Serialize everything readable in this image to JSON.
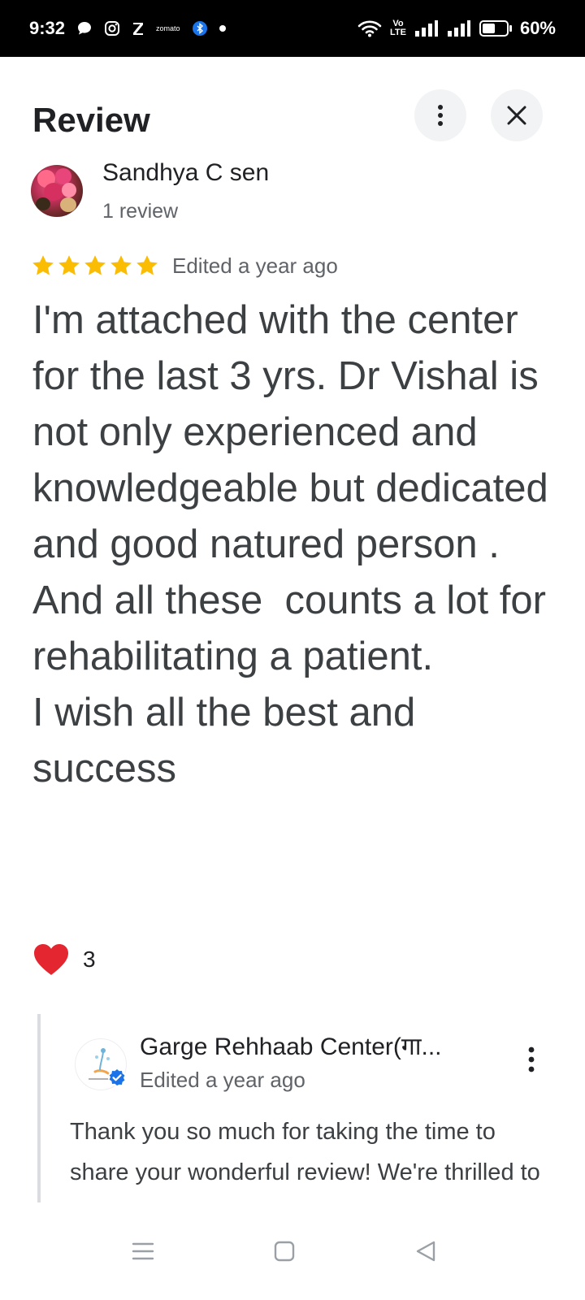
{
  "status_bar": {
    "time": "9:32",
    "left_icons": [
      "chat-icon",
      "instagram-icon",
      "zomato-z-icon",
      "zomato-label-icon",
      "bluetooth-icon",
      "dot-icon"
    ],
    "zomato_label": "zomato",
    "network_label_top": "Vo",
    "network_label_bottom": "LTE",
    "battery": "60%",
    "battery_level": 0.6
  },
  "header": {
    "title": "Review",
    "more_icon": "more-vert-icon",
    "close_icon": "close-icon"
  },
  "review": {
    "author": "Sandhya C sen",
    "author_meta": "1 review",
    "rating": 5,
    "rating_max": 5,
    "date": "Edited a year ago",
    "text": "I'm attached with the center for the last 3 yrs. Dr Vishal is not only experienced and knowledgeable but dedicated and good natured person .  And all these  counts a lot for rehabilitating a patient.\nI wish all the best and success",
    "likes": "3",
    "like_icon": "heart-icon"
  },
  "reply": {
    "owner": "Garge Rehhaab Center(गा...",
    "date": "Edited a year ago",
    "text": "Thank you so much for taking the time to share your wonderful review! We're thrilled to hear that our dedicated team",
    "verified_icon": "verified-badge-icon"
  },
  "nav": {
    "icons": [
      "menu-icon",
      "home-icon",
      "back-icon"
    ]
  },
  "colors": {
    "star": "#fbbc04",
    "heart": "#e3262f",
    "verified": "#1a73e8",
    "text_primary": "#202124",
    "text_secondary": "#5f6368"
  }
}
